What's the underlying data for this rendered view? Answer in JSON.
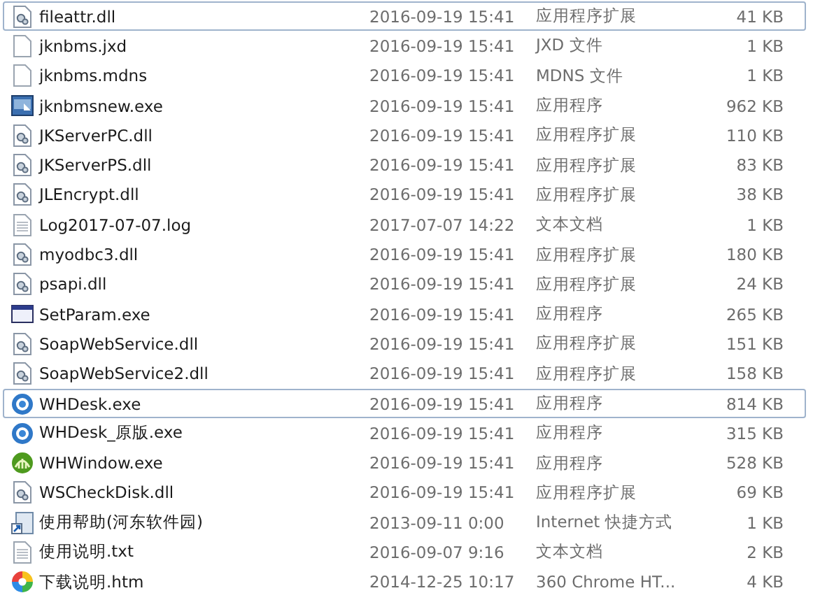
{
  "files": [
    {
      "name": "fileattr.dll",
      "modified": "2016-09-19 15:41",
      "type": "应用程序扩展",
      "size": "41 KB",
      "kind": "dll",
      "focused": true
    },
    {
      "name": "jknbms.jxd",
      "modified": "2016-09-19 15:41",
      "type": "JXD 文件",
      "size": "1 KB",
      "kind": "file",
      "focused": false
    },
    {
      "name": "jknbms.mdns",
      "modified": "2016-09-19 15:41",
      "type": "MDNS 文件",
      "size": "1 KB",
      "kind": "file",
      "focused": false
    },
    {
      "name": "jknbmsnew.exe",
      "modified": "2016-09-19 15:41",
      "type": "应用程序",
      "size": "962 KB",
      "kind": "app",
      "focused": false
    },
    {
      "name": "JKServerPC.dll",
      "modified": "2016-09-19 15:41",
      "type": "应用程序扩展",
      "size": "110 KB",
      "kind": "dll",
      "focused": false
    },
    {
      "name": "JKServerPS.dll",
      "modified": "2016-09-19 15:41",
      "type": "应用程序扩展",
      "size": "83 KB",
      "kind": "dll",
      "focused": false
    },
    {
      "name": "JLEncrypt.dll",
      "modified": "2016-09-19 15:41",
      "type": "应用程序扩展",
      "size": "38 KB",
      "kind": "dll",
      "focused": false
    },
    {
      "name": "Log2017-07-07.log",
      "modified": "2017-07-07 14:22",
      "type": "文本文档",
      "size": "1 KB",
      "kind": "text",
      "focused": false
    },
    {
      "name": "myodbc3.dll",
      "modified": "2016-09-19 15:41",
      "type": "应用程序扩展",
      "size": "180 KB",
      "kind": "dll",
      "focused": false
    },
    {
      "name": "psapi.dll",
      "modified": "2016-09-19 15:41",
      "type": "应用程序扩展",
      "size": "24 KB",
      "kind": "dll",
      "focused": false
    },
    {
      "name": "SetParam.exe",
      "modified": "2016-09-19 15:41",
      "type": "应用程序",
      "size": "265 KB",
      "kind": "window",
      "focused": false
    },
    {
      "name": "SoapWebService.dll",
      "modified": "2016-09-19 15:41",
      "type": "应用程序扩展",
      "size": "151 KB",
      "kind": "dll",
      "focused": false
    },
    {
      "name": "SoapWebService2.dll",
      "modified": "2016-09-19 15:41",
      "type": "应用程序扩展",
      "size": "158 KB",
      "kind": "dll",
      "focused": false
    },
    {
      "name": "WHDesk.exe",
      "modified": "2016-09-19 15:41",
      "type": "应用程序",
      "size": "814 KB",
      "kind": "blue-disc",
      "focused": true
    },
    {
      "name": "WHDesk_原版.exe",
      "modified": "2016-09-19 15:41",
      "type": "应用程序",
      "size": "315 KB",
      "kind": "blue-disc",
      "focused": false
    },
    {
      "name": "WHWindow.exe",
      "modified": "2016-09-19 15:41",
      "type": "应用程序",
      "size": "528 KB",
      "kind": "green-disc",
      "focused": false
    },
    {
      "name": "WSCheckDisk.dll",
      "modified": "2016-09-19 15:41",
      "type": "应用程序扩展",
      "size": "69 KB",
      "kind": "dll",
      "focused": false
    },
    {
      "name": "使用帮助(河东软件园)",
      "modified": "2013-09-11 0:00",
      "type": "Internet 快捷方式",
      "size": "1 KB",
      "kind": "shortcut",
      "focused": false
    },
    {
      "name": "使用说明.txt",
      "modified": "2016-09-07 9:16",
      "type": "文本文档",
      "size": "2 KB",
      "kind": "text",
      "focused": false
    },
    {
      "name": "下载说明.htm",
      "modified": "2014-12-25 10:17",
      "type": "360 Chrome HT...",
      "size": "4 KB",
      "kind": "color-wheel",
      "focused": false
    }
  ]
}
